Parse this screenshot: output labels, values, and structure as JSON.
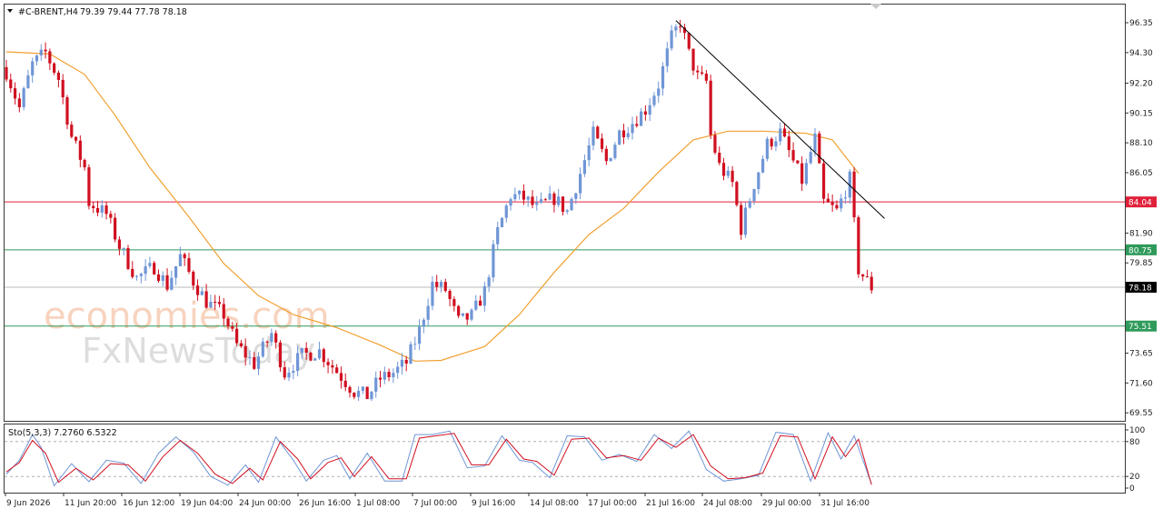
{
  "header": {
    "symbol": "#C-BRENT,H4",
    "ohlc": "79.39 79.44 77.78 78.18"
  },
  "watermark": {
    "line1": "economies.com",
    "line2": "FxNewsToday"
  },
  "colors": {
    "bull": "#6f96d6",
    "bear": "#d01020",
    "ma": "#f0a030",
    "resistance": "#e0203a",
    "support": "#2e9a5a",
    "price_line": "#b9b9b9",
    "trendline": "#000000",
    "stoch_main": "#6f96d6",
    "stoch_signal": "#d01020"
  },
  "chart_data": {
    "type": "candlestick",
    "title": "#C-BRENT,H4",
    "ylim": [
      69.0,
      97.6
    ],
    "y_ticks": [
      "96.35",
      "94.30",
      "92.20",
      "90.15",
      "88.10",
      "86.05",
      "84.04",
      "81.90",
      "80.75",
      "79.85",
      "78.18",
      "75.51",
      "73.65",
      "71.60",
      "69.55"
    ],
    "x_ticks": [
      "9 Jun 2026",
      "11 Jun 20:00",
      "16 Jun 12:00",
      "19 Jun 04:00",
      "24 Jun 00:00",
      "26 Jun 16:00",
      "1 Jul 08:00",
      "7 Jul 00:00",
      "9 Jul 16:00",
      "14 Jul 08:00",
      "17 Jul 00:00",
      "21 Jul 16:00",
      "24 Jul 08:00",
      "29 Jul 00:00",
      "31 Jul 16:00"
    ],
    "current_price": 78.18,
    "horizontal_levels": [
      {
        "label": "84.04",
        "value": 84.04,
        "color": "#e0203a"
      },
      {
        "label": "80.75",
        "value": 80.75,
        "color": "#2e9a5a"
      },
      {
        "label": "75.51",
        "value": 75.51,
        "color": "#2e9a5a"
      }
    ],
    "trendline": {
      "from_index": 154,
      "from_value": 96.5,
      "to_index": 202,
      "to_value": 82.9
    },
    "ma_series": [
      {
        "i": 0,
        "v": 94.35
      },
      {
        "i": 10,
        "v": 94.2
      },
      {
        "i": 18,
        "v": 92.8
      },
      {
        "i": 25,
        "v": 90.0
      },
      {
        "i": 33,
        "v": 86.4
      },
      {
        "i": 42,
        "v": 83.0
      },
      {
        "i": 50,
        "v": 79.8
      },
      {
        "i": 58,
        "v": 77.6
      },
      {
        "i": 66,
        "v": 76.3
      },
      {
        "i": 76,
        "v": 75.4
      },
      {
        "i": 86,
        "v": 74.2
      },
      {
        "i": 94,
        "v": 73.1
      },
      {
        "i": 100,
        "v": 73.15
      },
      {
        "i": 110,
        "v": 74.1
      },
      {
        "i": 118,
        "v": 76.3
      },
      {
        "i": 126,
        "v": 79.2
      },
      {
        "i": 134,
        "v": 81.8
      },
      {
        "i": 142,
        "v": 83.6
      },
      {
        "i": 150,
        "v": 86.1
      },
      {
        "i": 158,
        "v": 88.3
      },
      {
        "i": 166,
        "v": 88.9
      },
      {
        "i": 174,
        "v": 88.9
      },
      {
        "i": 184,
        "v": 88.75
      },
      {
        "i": 190,
        "v": 88.3
      },
      {
        "i": 196,
        "v": 86.0
      }
    ],
    "stochastic": {
      "label": "Sto(5,3,3) 7.2760 6.5322",
      "ylim": [
        0,
        100
      ],
      "levels": [
        80,
        20
      ],
      "tick_labels": [
        "100",
        "80",
        "20",
        "0"
      ],
      "main": [
        {
          "i": 0,
          "v": 24
        },
        {
          "i": 3,
          "v": 48
        },
        {
          "i": 6,
          "v": 92
        },
        {
          "i": 8,
          "v": 70
        },
        {
          "i": 11,
          "v": 4
        },
        {
          "i": 15,
          "v": 42
        },
        {
          "i": 19,
          "v": 11
        },
        {
          "i": 23,
          "v": 48
        },
        {
          "i": 27,
          "v": 43
        },
        {
          "i": 31,
          "v": 8
        },
        {
          "i": 35,
          "v": 60
        },
        {
          "i": 39,
          "v": 88
        },
        {
          "i": 43,
          "v": 62
        },
        {
          "i": 47,
          "v": 20
        },
        {
          "i": 51,
          "v": 5
        },
        {
          "i": 55,
          "v": 40
        },
        {
          "i": 58,
          "v": 10
        },
        {
          "i": 62,
          "v": 88
        },
        {
          "i": 66,
          "v": 48
        },
        {
          "i": 69,
          "v": 12
        },
        {
          "i": 73,
          "v": 48
        },
        {
          "i": 76,
          "v": 56
        },
        {
          "i": 79,
          "v": 16
        },
        {
          "i": 83,
          "v": 60
        },
        {
          "i": 87,
          "v": 12
        },
        {
          "i": 91,
          "v": 12
        },
        {
          "i": 94,
          "v": 92
        },
        {
          "i": 98,
          "v": 92
        },
        {
          "i": 102,
          "v": 98
        },
        {
          "i": 106,
          "v": 35
        },
        {
          "i": 110,
          "v": 38
        },
        {
          "i": 114,
          "v": 90
        },
        {
          "i": 118,
          "v": 48
        },
        {
          "i": 121,
          "v": 44
        },
        {
          "i": 125,
          "v": 18
        },
        {
          "i": 129,
          "v": 90
        },
        {
          "i": 133,
          "v": 88
        },
        {
          "i": 137,
          "v": 48
        },
        {
          "i": 141,
          "v": 58
        },
        {
          "i": 145,
          "v": 46
        },
        {
          "i": 149,
          "v": 92
        },
        {
          "i": 153,
          "v": 68
        },
        {
          "i": 157,
          "v": 98
        },
        {
          "i": 161,
          "v": 32
        },
        {
          "i": 165,
          "v": 12
        },
        {
          "i": 169,
          "v": 16
        },
        {
          "i": 173,
          "v": 22
        },
        {
          "i": 177,
          "v": 96
        },
        {
          "i": 181,
          "v": 92
        },
        {
          "i": 185,
          "v": 12
        },
        {
          "i": 189,
          "v": 95
        },
        {
          "i": 192,
          "v": 50
        },
        {
          "i": 195,
          "v": 90
        },
        {
          "i": 199,
          "v": 7
        }
      ],
      "signal": [
        {
          "i": 0,
          "v": 28
        },
        {
          "i": 3,
          "v": 44
        },
        {
          "i": 6,
          "v": 82
        },
        {
          "i": 9,
          "v": 60
        },
        {
          "i": 12,
          "v": 10
        },
        {
          "i": 16,
          "v": 34
        },
        {
          "i": 20,
          "v": 14
        },
        {
          "i": 24,
          "v": 42
        },
        {
          "i": 28,
          "v": 40
        },
        {
          "i": 32,
          "v": 12
        },
        {
          "i": 36,
          "v": 54
        },
        {
          "i": 40,
          "v": 82
        },
        {
          "i": 44,
          "v": 60
        },
        {
          "i": 48,
          "v": 24
        },
        {
          "i": 52,
          "v": 8
        },
        {
          "i": 56,
          "v": 34
        },
        {
          "i": 59,
          "v": 14
        },
        {
          "i": 63,
          "v": 80
        },
        {
          "i": 67,
          "v": 50
        },
        {
          "i": 70,
          "v": 16
        },
        {
          "i": 74,
          "v": 44
        },
        {
          "i": 77,
          "v": 52
        },
        {
          "i": 80,
          "v": 20
        },
        {
          "i": 84,
          "v": 54
        },
        {
          "i": 88,
          "v": 16
        },
        {
          "i": 92,
          "v": 16
        },
        {
          "i": 95,
          "v": 86
        },
        {
          "i": 99,
          "v": 90
        },
        {
          "i": 103,
          "v": 94
        },
        {
          "i": 107,
          "v": 40
        },
        {
          "i": 111,
          "v": 40
        },
        {
          "i": 115,
          "v": 84
        },
        {
          "i": 119,
          "v": 50
        },
        {
          "i": 122,
          "v": 46
        },
        {
          "i": 126,
          "v": 22
        },
        {
          "i": 130,
          "v": 84
        },
        {
          "i": 134,
          "v": 86
        },
        {
          "i": 138,
          "v": 52
        },
        {
          "i": 142,
          "v": 56
        },
        {
          "i": 146,
          "v": 48
        },
        {
          "i": 150,
          "v": 86
        },
        {
          "i": 154,
          "v": 70
        },
        {
          "i": 158,
          "v": 92
        },
        {
          "i": 162,
          "v": 38
        },
        {
          "i": 166,
          "v": 16
        },
        {
          "i": 170,
          "v": 18
        },
        {
          "i": 174,
          "v": 26
        },
        {
          "i": 178,
          "v": 90
        },
        {
          "i": 182,
          "v": 88
        },
        {
          "i": 186,
          "v": 16
        },
        {
          "i": 190,
          "v": 88
        },
        {
          "i": 193,
          "v": 54
        },
        {
          "i": 196,
          "v": 84
        },
        {
          "i": 199,
          "v": 6
        }
      ]
    },
    "price_path": [
      {
        "i": 0,
        "v": 93.0
      },
      {
        "i": 3,
        "v": 90.5
      },
      {
        "i": 6,
        "v": 93.5
      },
      {
        "i": 9,
        "v": 94.3
      },
      {
        "i": 12,
        "v": 92.5
      },
      {
        "i": 15,
        "v": 88.5
      },
      {
        "i": 18,
        "v": 86.4
      },
      {
        "i": 19,
        "v": 84.0
      },
      {
        "i": 23,
        "v": 83.2
      },
      {
        "i": 26,
        "v": 81.0
      },
      {
        "i": 30,
        "v": 78.8
      },
      {
        "i": 34,
        "v": 79.6
      },
      {
        "i": 37,
        "v": 78.3
      },
      {
        "i": 40,
        "v": 80.3
      },
      {
        "i": 43,
        "v": 78.6
      },
      {
        "i": 46,
        "v": 77.2
      },
      {
        "i": 50,
        "v": 76.3
      },
      {
        "i": 53,
        "v": 74.2
      },
      {
        "i": 57,
        "v": 72.9
      },
      {
        "i": 61,
        "v": 75.0
      },
      {
        "i": 64,
        "v": 72.3
      },
      {
        "i": 68,
        "v": 73.5
      },
      {
        "i": 72,
        "v": 73.8
      },
      {
        "i": 76,
        "v": 72.4
      },
      {
        "i": 80,
        "v": 71.0
      },
      {
        "i": 83,
        "v": 70.7
      },
      {
        "i": 86,
        "v": 71.9
      },
      {
        "i": 89,
        "v": 72.3
      },
      {
        "i": 92,
        "v": 73.0
      },
      {
        "i": 95,
        "v": 75.2
      },
      {
        "i": 98,
        "v": 78.4
      },
      {
        "i": 101,
        "v": 78.0
      },
      {
        "i": 104,
        "v": 75.8
      },
      {
        "i": 107,
        "v": 76.2
      },
      {
        "i": 110,
        "v": 77.9
      },
      {
        "i": 113,
        "v": 82.0
      },
      {
        "i": 116,
        "v": 84.5
      },
      {
        "i": 119,
        "v": 84.3
      },
      {
        "i": 122,
        "v": 83.6
      },
      {
        "i": 126,
        "v": 84.3
      },
      {
        "i": 129,
        "v": 83.4
      },
      {
        "i": 132,
        "v": 86.0
      },
      {
        "i": 135,
        "v": 88.7
      },
      {
        "i": 138,
        "v": 86.8
      },
      {
        "i": 141,
        "v": 88.8
      },
      {
        "i": 144,
        "v": 89.5
      },
      {
        "i": 147,
        "v": 90.4
      },
      {
        "i": 150,
        "v": 92.1
      },
      {
        "i": 153,
        "v": 95.3
      },
      {
        "i": 155,
        "v": 96.4
      },
      {
        "i": 157,
        "v": 94.2
      },
      {
        "i": 159,
        "v": 92.6
      },
      {
        "i": 161,
        "v": 92.3
      },
      {
        "i": 162,
        "v": 88.6
      },
      {
        "i": 164,
        "v": 86.5
      },
      {
        "i": 167,
        "v": 85.3
      },
      {
        "i": 169,
        "v": 82.2
      },
      {
        "i": 172,
        "v": 85.3
      },
      {
        "i": 175,
        "v": 88.0
      },
      {
        "i": 178,
        "v": 88.8
      },
      {
        "i": 181,
        "v": 86.8
      },
      {
        "i": 183,
        "v": 85.5
      },
      {
        "i": 186,
        "v": 88.4
      },
      {
        "i": 188,
        "v": 84.0
      },
      {
        "i": 191,
        "v": 83.4
      },
      {
        "i": 194,
        "v": 85.6
      },
      {
        "i": 196,
        "v": 79.4
      },
      {
        "i": 199,
        "v": 78.18
      }
    ]
  }
}
